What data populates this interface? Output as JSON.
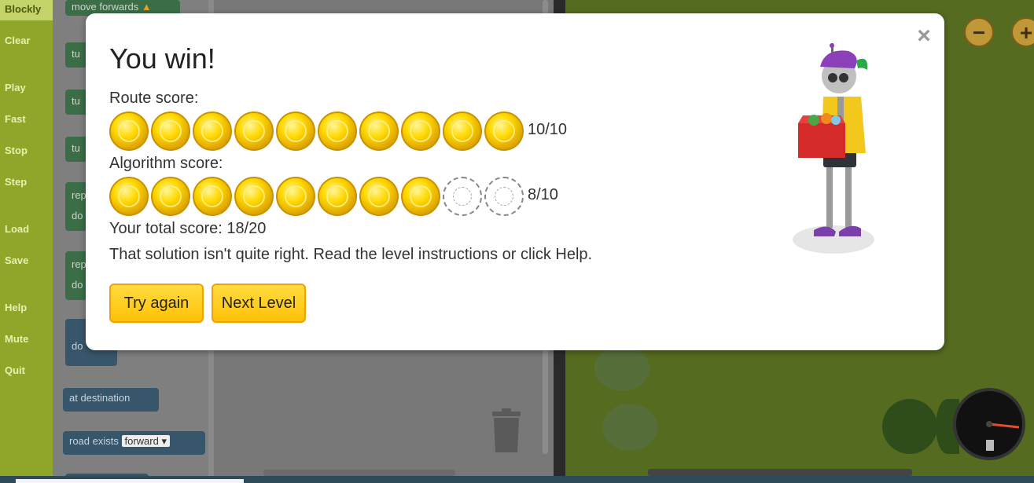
{
  "menu": {
    "items": [
      "Blockly",
      "Clear",
      "Play",
      "Fast",
      "Stop",
      "Step",
      "Load",
      "Save",
      "Help",
      "Mute",
      "Quit"
    ]
  },
  "toolbox": {
    "blocks": [
      "move forwards",
      "tu",
      "tu",
      "tu",
      "rep",
      "do",
      "rep",
      "do",
      "do",
      "at destination",
      "road exists",
      "forward"
    ]
  },
  "modal": {
    "title": "You win!",
    "route_label": "Route score:",
    "route_score": "10/10",
    "route_earned": 10,
    "route_total": 10,
    "algorithm_label": "Algorithm score:",
    "algorithm_score": "8/10",
    "algorithm_earned": 8,
    "algorithm_total": 10,
    "total_score": "Your total score: 18/20",
    "message": "That solution isn't quite right. Read the level instructions or click Help.",
    "try_again_label": "Try again",
    "next_level_label": "Next Level",
    "close_glyph": "×"
  },
  "map": {
    "zoom_out_glyph": "−",
    "zoom_in_glyph": "+"
  },
  "colors": {
    "button": "#ffc107",
    "coin_gold": "#ffd900"
  }
}
